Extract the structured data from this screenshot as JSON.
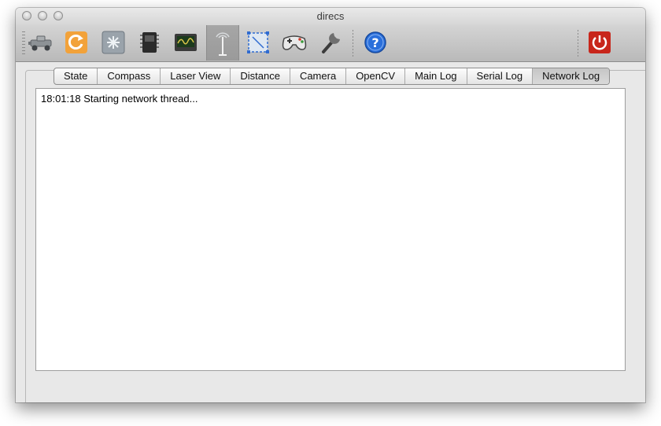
{
  "window": {
    "title": "direcs"
  },
  "toolbar": {
    "tools": [
      {
        "name": "robot-icon"
      },
      {
        "name": "reset-icon"
      },
      {
        "name": "sensor-icon"
      },
      {
        "name": "chip-icon"
      },
      {
        "name": "oscilloscope-icon"
      },
      {
        "name": "antenna-icon",
        "active": true
      },
      {
        "name": "selection-icon"
      },
      {
        "name": "gamepad-icon"
      },
      {
        "name": "wrench-icon"
      },
      {
        "name": "help-icon"
      },
      {
        "name": "power-icon"
      }
    ]
  },
  "tabs": [
    {
      "label": "State"
    },
    {
      "label": "Compass"
    },
    {
      "label": "Laser View"
    },
    {
      "label": "Distance"
    },
    {
      "label": "Camera"
    },
    {
      "label": "OpenCV"
    },
    {
      "label": "Main Log"
    },
    {
      "label": "Serial Log"
    },
    {
      "label": "Network Log",
      "selected": true
    }
  ],
  "network_log": {
    "lines": [
      "18:01:18 Starting network thread..."
    ]
  },
  "colors": {
    "window_bg": "#e8e8e8",
    "reset_orange": "#f2a23a",
    "help_blue": "#2a6fdb",
    "power_red": "#c8261b"
  }
}
